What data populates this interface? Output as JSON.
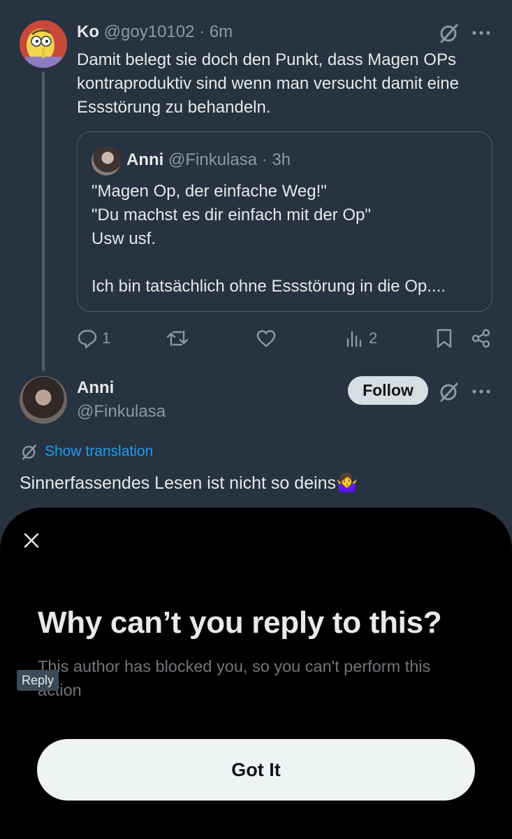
{
  "tweet1": {
    "display_name": "Ko",
    "handle": "@goy10102",
    "time": "6m",
    "text": "Damit belegt sie doch den Punkt, dass Magen OPs kontraproduktiv sind wenn man versucht damit eine Essstörung zu behandeln.",
    "quote": {
      "display_name": "Anni",
      "handle": "@Finkulasa",
      "time": "3h",
      "line1": "\"Magen Op, der einfache Weg!\"",
      "line2": "\"Du machst es dir einfach mit der Op\"",
      "line3": "Usw usf.",
      "line4": "Ich bin tatsächlich ohne Essstörung in die Op...."
    },
    "actions": {
      "reply_count": "1",
      "view_count": "2"
    }
  },
  "tweet2": {
    "display_name": "Anni",
    "handle": "@Finkulasa",
    "follow_label": "Follow",
    "show_translation": "Show translation",
    "text": "Sinnerfassendes Lesen ist nicht so deins",
    "emoji": "🤷‍♀️"
  },
  "sheet": {
    "title": "Why can’t you reply to this?",
    "body": "This author has blocked you, so you can't perform this action",
    "tooltip": "Reply",
    "button_label": "Got It"
  },
  "colors": {
    "background": "#273340",
    "link": "#1d9bf0",
    "sheet_bg": "#000000"
  }
}
